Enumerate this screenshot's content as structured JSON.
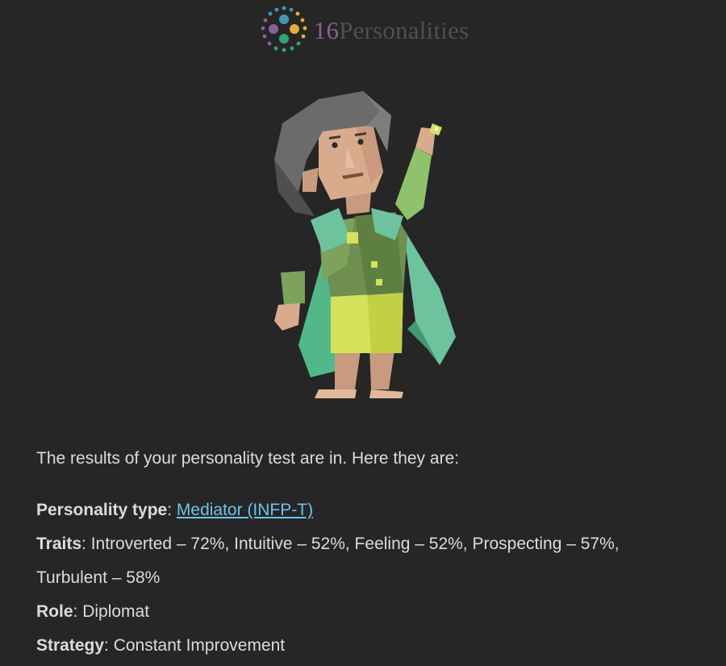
{
  "brand": {
    "number": "16",
    "word": "Personalities",
    "colors": {
      "purple": "#88619a",
      "teal": "#4298b4",
      "green": "#33a474",
      "yellow": "#e4ae3a",
      "gray": "#4f4f4f"
    }
  },
  "illustration": {
    "icon": "mediator-character-illustration"
  },
  "intro": "The results of your personality test are in. Here they are:",
  "results": {
    "type": {
      "label": "Personality type",
      "value": "Mediator (INFP-T)"
    },
    "traits": {
      "label": "Traits",
      "value": "Introverted – 72%, Intuitive – 52%, Feeling – 52%, Prospecting – 57%, Turbulent – 58%"
    },
    "role": {
      "label": "Role",
      "value": "Diplomat"
    },
    "strategy": {
      "label": "Strategy",
      "value": "Constant Improvement"
    }
  },
  "theme": {
    "background": "#262626",
    "text": "#dcdcdc",
    "link": "#6ec3ea"
  }
}
